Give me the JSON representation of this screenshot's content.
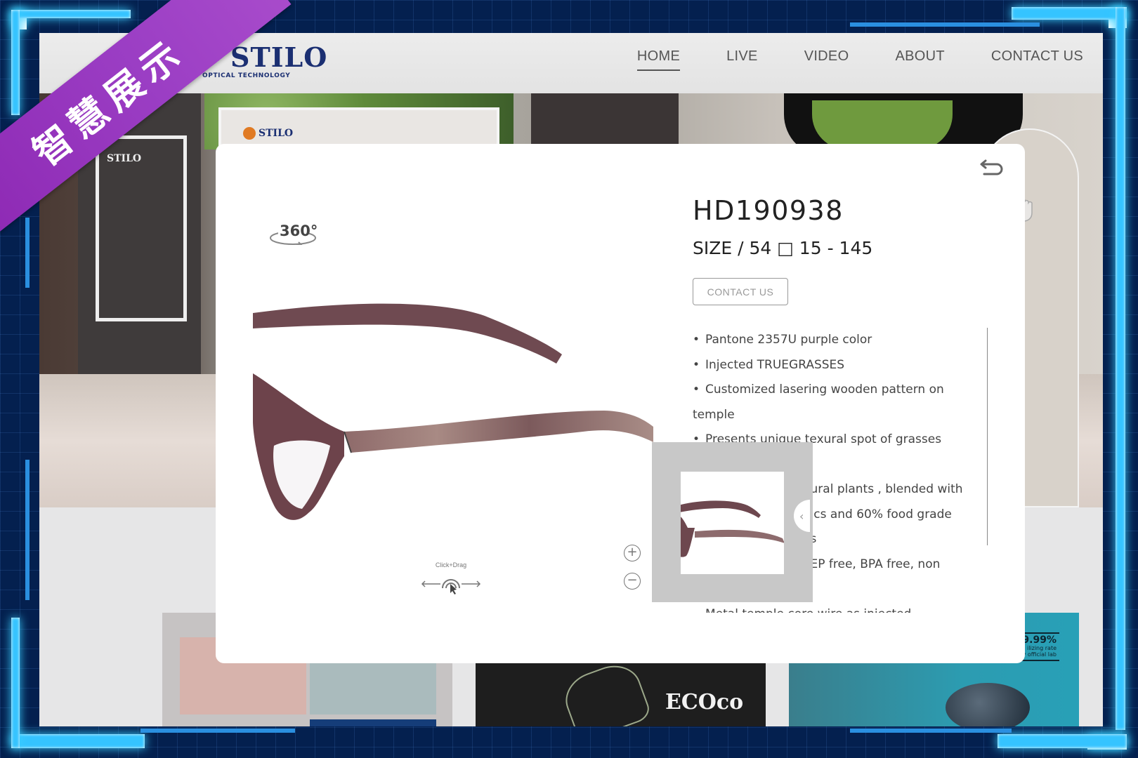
{
  "ribbon": {
    "text": "智慧展示"
  },
  "header": {
    "logo": {
      "word": "STILO",
      "subtitle": "OPTICAL TECHNOLOGY"
    },
    "nav": [
      {
        "label": "HOME",
        "active": true
      },
      {
        "label": "LIVE",
        "active": false
      },
      {
        "label": "VIDEO",
        "active": false
      },
      {
        "label": "ABOUT",
        "active": false
      },
      {
        "label": "CONTACT US",
        "active": false
      }
    ]
  },
  "hero": {
    "wall_sign": "STILO",
    "poster_logo": "STILO"
  },
  "tiles": [
    {
      "name": "eyewear-collection",
      "text": ""
    },
    {
      "name": "ecoco",
      "text": "ECOco"
    },
    {
      "name": "sterilizing",
      "stat": "9.99%",
      "line1": "ilizing rate",
      "line2": "by official lab"
    }
  ],
  "modal": {
    "badge_360": "360°",
    "drag_hint": "Click+Drag",
    "zoom_in": "+",
    "zoom_out": "−",
    "product": {
      "model": "HD190938",
      "size": "SIZE / 54 □ 15 - 145",
      "contact_label": "CONTACT US",
      "features": [
        {
          "bullet": "•",
          "text": "Pantone 2357U purple color"
        },
        {
          "bullet": "•",
          "text": "Injected TRUEGRASSES"
        },
        {
          "bullet": "•",
          "text": "Customized lasering wooden pattern on"
        },
        {
          "bullet": "",
          "text": "temple"
        },
        {
          "bullet": "•",
          "text": "Presents unique texural spot of grasses"
        },
        {
          "bullet": "",
          "text": ""
        },
        {
          "bullet": "",
          "text": "                               ural plants , blended with"
        },
        {
          "bullet": "",
          "text": "                               ics and 60% food grade"
        },
        {
          "bullet": "",
          "text": "                               s"
        },
        {
          "bullet": "",
          "text": "                               EP free, BPA free, non"
        },
        {
          "bullet": "",
          "text": ""
        },
        {
          "bullet": "",
          "text": "Metal temple core wire as injected"
        }
      ]
    },
    "thumbnail": {
      "prev_icon": "‹"
    }
  }
}
